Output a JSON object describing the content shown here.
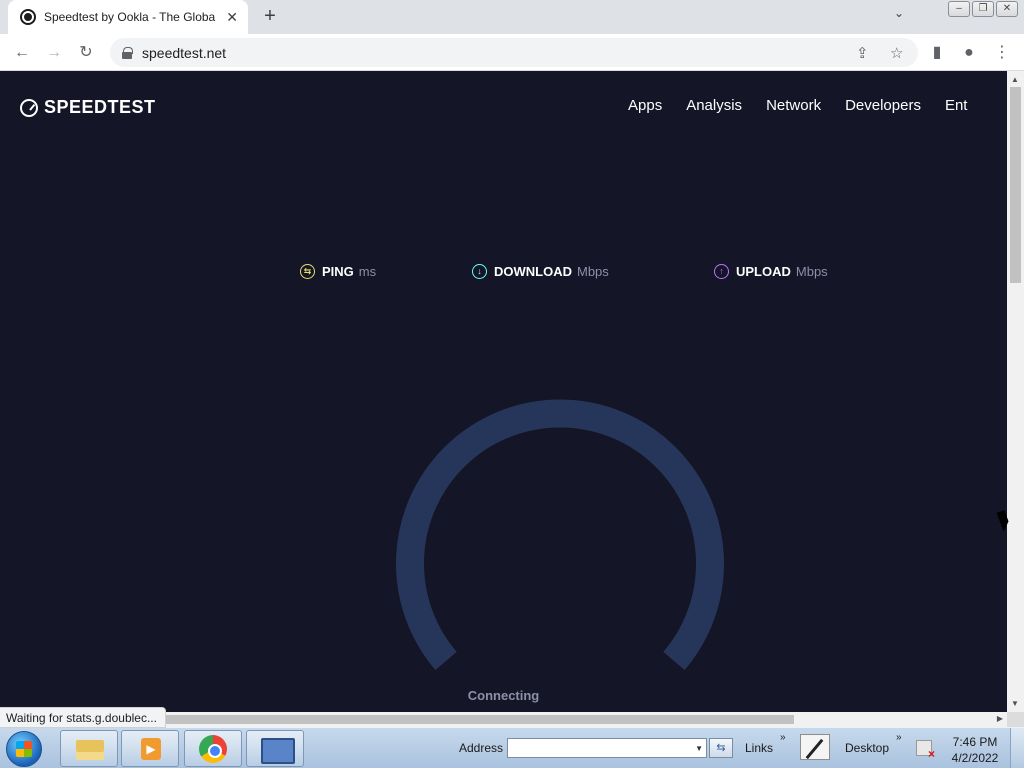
{
  "browser": {
    "tab_title": "Speedtest by Ookla - The Global",
    "tab_close": "✕",
    "new_tab": "+",
    "tab_list": "⌄",
    "window": {
      "minimize": "–",
      "restore": "❐",
      "close": "✕"
    },
    "nav": {
      "back": "←",
      "forward": "→",
      "reload": "↻"
    },
    "url": "speedtest.net",
    "share": "⇪",
    "bookmark": "☆",
    "sidepanel": "▮",
    "profile": "●",
    "menu": "⋮"
  },
  "site": {
    "logo_text": "SPEEDTEST",
    "nav": [
      "Apps",
      "Analysis",
      "Network",
      "Developers",
      "Ent"
    ],
    "metrics": {
      "ping": {
        "label": "PING",
        "unit": "ms",
        "icon": "⇆"
      },
      "download": {
        "label": "DOWNLOAD",
        "unit": "Mbps",
        "icon": "↓"
      },
      "upload": {
        "label": "UPLOAD",
        "unit": "Mbps",
        "icon": "↑"
      }
    },
    "status": "Connecting",
    "gauge_color": "#26365a",
    "background": "#141526"
  },
  "status_bubble": "Waiting for stats.g.doublec...",
  "scrollbars": {
    "up": "▲",
    "down": "▼",
    "right": "▶"
  },
  "taskbar": {
    "address_label": "Address",
    "address_value": "",
    "address_dropdown": "▼",
    "go": "⇆",
    "links_label": "Links",
    "links_chevron": "»",
    "desktop_label": "Desktop",
    "desktop_chevron": "»",
    "time": "7:46 PM",
    "date": "4/2/2022"
  }
}
